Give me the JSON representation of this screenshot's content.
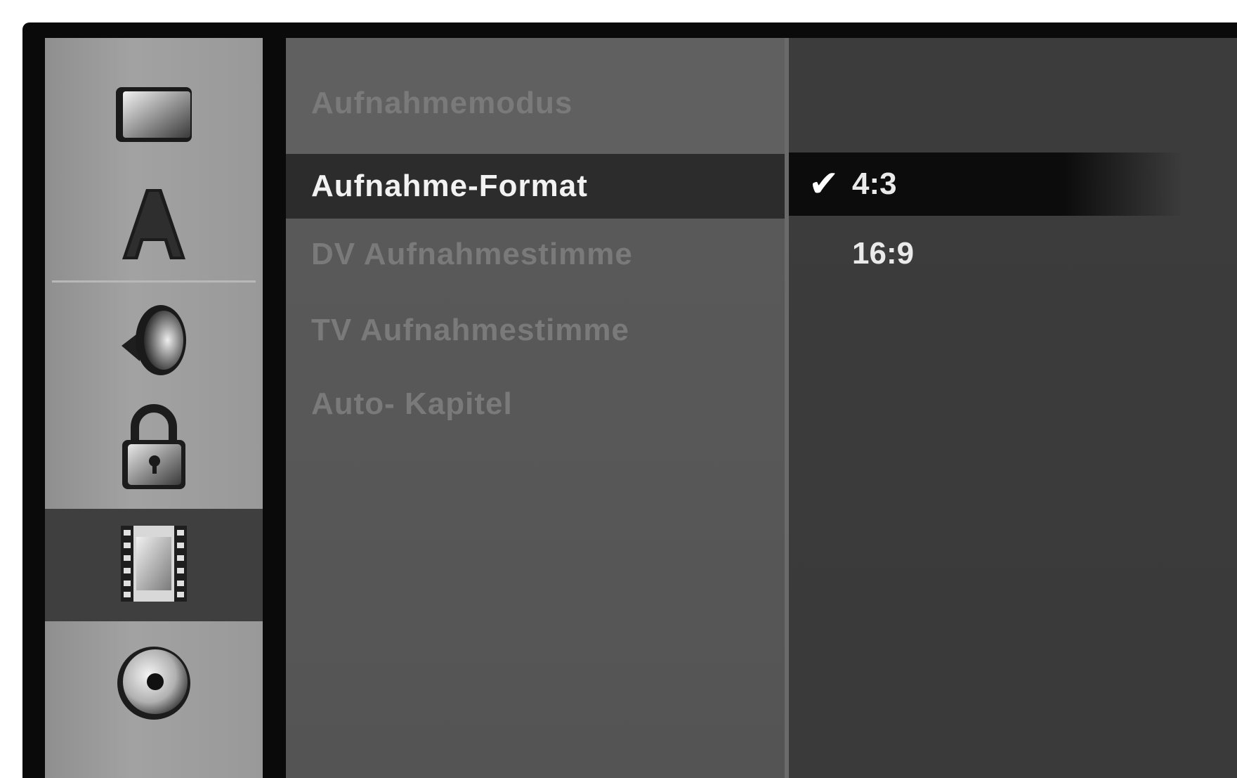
{
  "sidebar": {
    "items": [
      {
        "icon": "tv-screen-icon",
        "active": false
      },
      {
        "icon": "language-letter-a-icon",
        "active": false
      },
      {
        "icon": "speaker-audio-icon",
        "active": false
      },
      {
        "icon": "padlock-icon",
        "active": false
      },
      {
        "icon": "film-record-icon",
        "active": true
      },
      {
        "icon": "disc-icon",
        "active": false
      }
    ]
  },
  "menu": {
    "items": [
      {
        "label": "Aufnahmemodus"
      },
      {
        "label": "Aufnahme-Format"
      },
      {
        "label": "DV Aufnahmestimme"
      },
      {
        "label": "TV Aufnahmestimme"
      },
      {
        "label": "Auto- Kapitel"
      }
    ],
    "selected_index": 1
  },
  "options": {
    "items": [
      {
        "label": "4:3",
        "checked": true
      },
      {
        "label": "16:9",
        "checked": false
      }
    ],
    "check_glyph": "✔"
  },
  "colors": {
    "highlight": "#2c2c2c",
    "option_highlight": "#0c0c0c",
    "active_icon_bg": "#3f3f3f"
  }
}
